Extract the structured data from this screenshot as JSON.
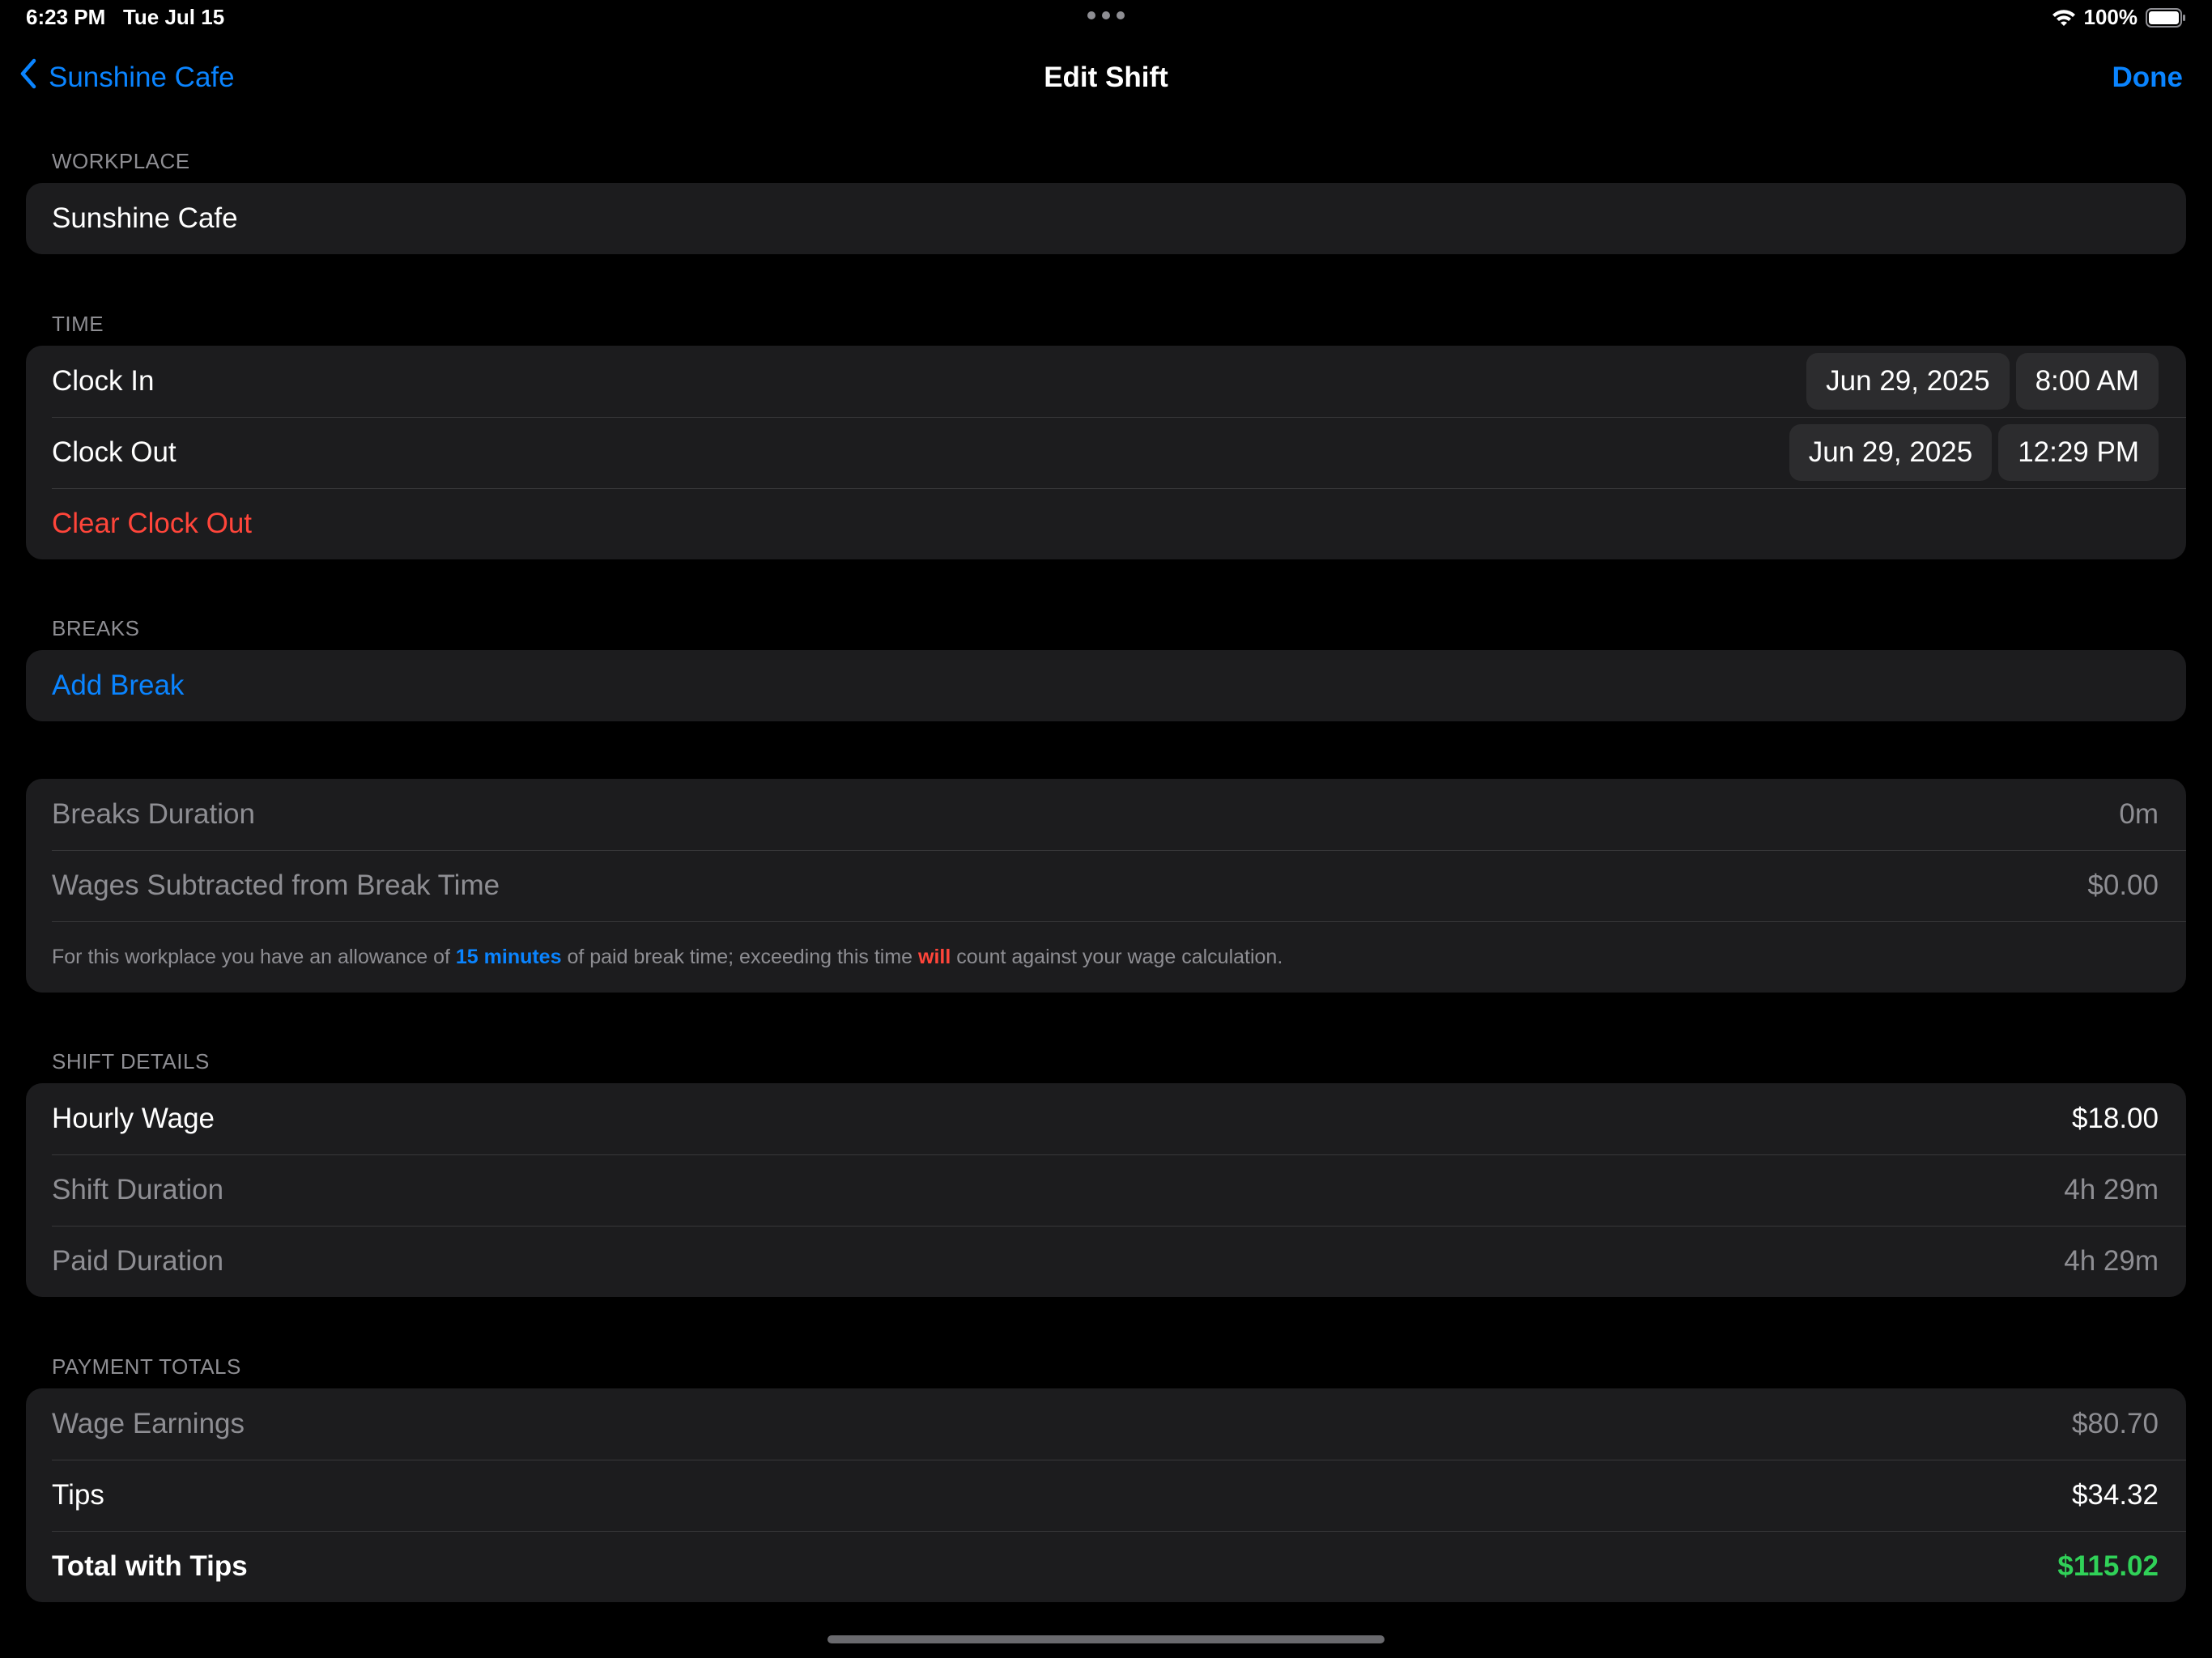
{
  "status_bar": {
    "time": "6:23 PM",
    "date": "Tue Jul 15",
    "battery": "100%"
  },
  "nav": {
    "back_label": "Sunshine Cafe",
    "title": "Edit Shift",
    "done_label": "Done"
  },
  "workplace": {
    "header": "WORKPLACE",
    "name": "Sunshine Cafe"
  },
  "time": {
    "header": "TIME",
    "clock_in": {
      "label": "Clock In",
      "date": "Jun 29, 2025",
      "time": "8:00 AM"
    },
    "clock_out": {
      "label": "Clock Out",
      "date": "Jun 29, 2025",
      "time": "12:29 PM"
    },
    "clear_label": "Clear Clock Out"
  },
  "breaks": {
    "header": "BREAKS",
    "add_label": "Add Break"
  },
  "break_summary": {
    "duration_label": "Breaks Duration",
    "duration_value": "0m",
    "wages_label": "Wages Subtracted from Break Time",
    "wages_value": "$0.00",
    "note": {
      "part1": "For this workplace you have an allowance of ",
      "highlight1": "15 minutes",
      "part2": " of paid break time; exceeding this time ",
      "highlight2": "will",
      "part3": " count against your wage calculation."
    }
  },
  "shift_details": {
    "header": "SHIFT DETAILS",
    "hourly_wage_label": "Hourly Wage",
    "hourly_wage_value": "$18.00",
    "shift_duration_label": "Shift Duration",
    "shift_duration_value": "4h 29m",
    "paid_duration_label": "Paid Duration",
    "paid_duration_value": "4h 29m"
  },
  "payment_totals": {
    "header": "PAYMENT TOTALS",
    "wage_earnings_label": "Wage Earnings",
    "wage_earnings_value": "$80.70",
    "tips_label": "Tips",
    "tips_value": "$34.32",
    "total_label": "Total with Tips",
    "total_value": "$115.02"
  },
  "colors": {
    "background": "#000000",
    "card": "#1c1c1e",
    "accent_blue": "#0a84ff",
    "destructive_red": "#ff453a",
    "positive_green": "#30d158",
    "secondary_text": "#8e8e93"
  },
  "icons": {
    "back": "chevron-left-icon",
    "wifi": "wifi-icon",
    "battery": "battery-icon",
    "multitask": "more-dots-icon"
  }
}
